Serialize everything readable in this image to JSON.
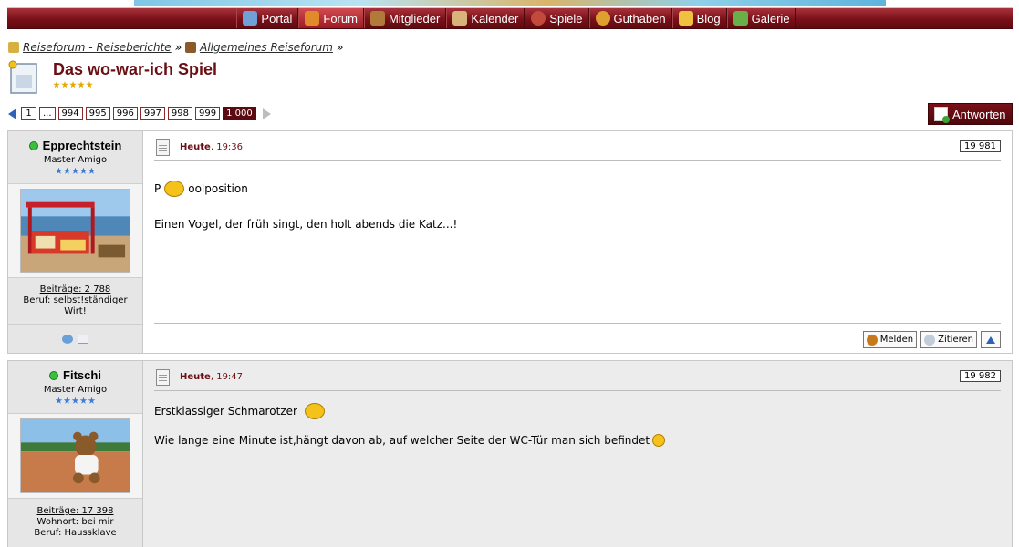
{
  "nav": {
    "items": [
      {
        "label": "Portal",
        "icon": "portal-icon",
        "color": "#6fa0d8"
      },
      {
        "label": "Forum",
        "icon": "forum-icon",
        "color": "#e08a2c"
      },
      {
        "label": "Mitglieder",
        "icon": "members-icon",
        "color": "#b07a3a"
      },
      {
        "label": "Kalender",
        "icon": "calendar-icon",
        "color": "#d8b47a"
      },
      {
        "label": "Spiele",
        "icon": "games-icon",
        "color": "#c24a3a"
      },
      {
        "label": "Guthaben",
        "icon": "credit-icon",
        "color": "#e0a030"
      },
      {
        "label": "Blog",
        "icon": "blog-icon",
        "color": "#f0c040"
      },
      {
        "label": "Galerie",
        "icon": "gallery-icon",
        "color": "#6ab04a"
      }
    ],
    "active": "Forum"
  },
  "breadcrumb": {
    "items": [
      "Reiseforum - Reiseberichte",
      "Allgemeines Reiseforum"
    ],
    "separator": "»"
  },
  "thread": {
    "title": "Das wo-war-ich Spiel",
    "rating": 5
  },
  "pagination": {
    "pages": [
      "1",
      "...",
      "994",
      "995",
      "996",
      "997",
      "998",
      "999",
      "1 000"
    ],
    "current": "1 000"
  },
  "reply_button": {
    "label": "Antworten"
  },
  "posts": [
    {
      "author": "Epprechtstein",
      "online": true,
      "rank": "Master Amigo",
      "stars": 5,
      "avatar": "beach-hut-photo",
      "posts_label": "Beiträge: 2 788",
      "info": [
        "Beruf: selbst!ständiger Wirt!"
      ],
      "date_day": "Heute",
      "date_time": ", 19:36",
      "number": "19 981",
      "text_before": "P",
      "text_after": "oolposition",
      "signature": "Einen Vogel, der früh singt, den holt abends die Katz...!",
      "buttons": {
        "report": "Melden",
        "quote": "Zitieren"
      }
    },
    {
      "author": "Fitschi",
      "online": true,
      "rank": "Master Amigo",
      "stars": 5,
      "avatar": "teddy-bear-photo",
      "posts_label": "Beiträge: 17 398",
      "info": [
        "Wohnort: bei mir",
        "Beruf: Haussklave"
      ],
      "date_day": "Heute",
      "date_time": ", 19:47",
      "number": "19 982",
      "text": "Erstklassiger Schmarotzer",
      "signature": "Wie lange eine Minute ist,hängt davon ab, auf welcher Seite der WC-Tür man sich befindet"
    }
  ],
  "colors": {
    "accent": "#6a0f14",
    "nav_bg": "#7a1018"
  }
}
